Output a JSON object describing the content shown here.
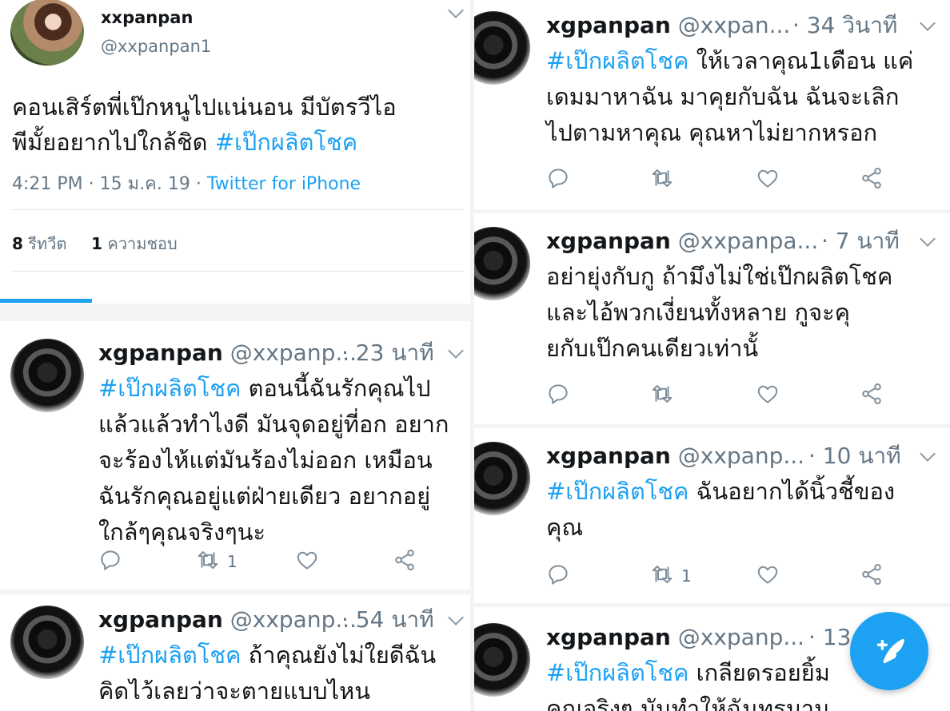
{
  "main_tweet": {
    "name": "xxpanpan",
    "handle": "@xxpanpan1",
    "text_lines": [
      "คอนเสิร์ตพี่เป๊กหนูไปแน่นอน มีบัตรวีไอ",
      "พีมั้ยอยากไปใกล้ชิด "
    ],
    "hashtag": "#เป๊กผลิตโชค",
    "time": "4:21 PM",
    "date": "15 ม.ค. 19",
    "source": "Twitter for iPhone",
    "retweets_count": "8",
    "retweets_label": "รีทวีต",
    "likes_count": "1",
    "likes_label": "ความชอบ"
  },
  "left_replies": [
    {
      "name": "xgpanpan",
      "handle": "@xxpanp...",
      "time": "· 23 นาที",
      "hashtag": "#เป๊กผลิตโชค",
      "lines": [
        " ตอนนี้ฉันรักคุณไป",
        "แล้วแล้วทำไงดี มันจุดอยู่ที่อก อยาก",
        "จะร้องไห้แต่มันร้องไม่ออก เหมือน",
        "ฉันรักคุณอยู่แต่ฝ่ายเดียว อยากอยู่",
        "ใกล้ๆคุณจริงๆนะ"
      ],
      "retweet_count": "1"
    },
    {
      "name": "xgpanpan",
      "handle": "@xxpanp...",
      "time": "· 54 นาที",
      "hashtag": "#เป๊กผลิตโชค",
      "lines": [
        " ถ้าคุณยังไม่ใยดีฉัน",
        "คิดไว้เลยว่าจะตายแบบไหน"
      ],
      "retweet_count": ""
    }
  ],
  "right_replies": [
    {
      "name": "xgpanpan",
      "handle": "@xxpan...",
      "time": "· 34 วินาที",
      "hashtag": "#เป๊กผลิตโชค",
      "lines": [
        " ให้เวลาคุณ1เดือน แค่",
        "เดมมาหาฉัน มาคุยกับฉัน ฉันจะเลิก",
        "ไปตามหาคุณ คุณหาไม่ยากหรอก"
      ],
      "retweet_count": ""
    },
    {
      "name": "xgpanpan",
      "handle": "@xxpanpa...",
      "time": "· 7 นาที",
      "hashtag": "",
      "lines": [
        "อย่ายุ่งกับกู ถ้ามึงไม่ใช่เป๊กผลิตโชค",
        "และไอ้พวกเงี่ยนทั้งหลาย กูจะคุ",
        "ยกับเป๊กคนเดียวเท่านั้"
      ],
      "retweet_count": ""
    },
    {
      "name": "xgpanpan",
      "handle": "@xxpanp...",
      "time": "· 10 นาที",
      "hashtag": "#เป๊กผลิตโชค",
      "lines": [
        " ฉันอยากได้นิ้วชี้ของ",
        "คุณ"
      ],
      "retweet_count": "1"
    },
    {
      "name": "xgpanpan",
      "handle": "@xxpanp...",
      "time": "· 13",
      "hashtag": "#เป๊กผลิตโชค",
      "lines": [
        " เกลียดรอยยิ้ม",
        "คุณจริงๆ มันทำให้ฉันทรมาน"
      ],
      "retweet_count": ""
    }
  ],
  "icons": {
    "reply": "reply-icon",
    "retweet": "retweet-icon",
    "like": "heart-icon",
    "share": "share-icon",
    "compose": "compose-tweet-icon"
  },
  "colors": {
    "accent": "#1da1f2",
    "muted": "#657786",
    "text": "#14171a"
  }
}
